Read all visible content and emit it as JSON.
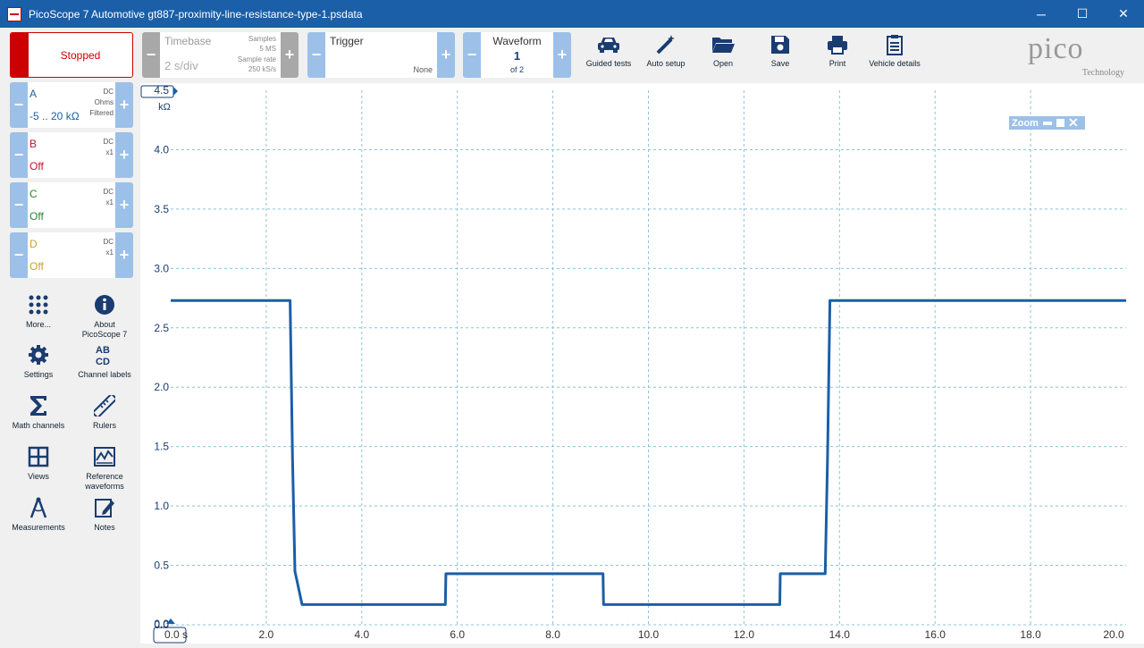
{
  "window": {
    "title": "PicoScope 7 Automotive gt887-proximity-line-resistance-type-1.psdata",
    "minimize": "─",
    "maximize": "☐",
    "close": "✕"
  },
  "run_status": "Stopped",
  "timebase": {
    "label": "Timebase",
    "value": "2 s/div",
    "samples_label": "Samples",
    "samples_value": "5 MS",
    "rate_label": "Sample rate",
    "rate_value": "250 kS/s"
  },
  "trigger": {
    "label": "Trigger",
    "value": "None"
  },
  "waveform": {
    "label": "Waveform",
    "value": "1",
    "of": "of 2"
  },
  "toolbar": [
    {
      "label": "Guided tests",
      "icon": "car-icon"
    },
    {
      "label": "Auto setup",
      "icon": "wand-icon"
    },
    {
      "label": "Open",
      "icon": "folder-icon"
    },
    {
      "label": "Save",
      "icon": "save-icon"
    },
    {
      "label": "Print",
      "icon": "printer-icon"
    },
    {
      "label": "Vehicle details",
      "icon": "clipboard-icon"
    }
  ],
  "logo": {
    "text": "pico",
    "sub": "Technology"
  },
  "channels": [
    {
      "name": "A",
      "coupling": "DC",
      "probe": "Ohms",
      "filter": "Filtered",
      "range": "-5 .. 20 kΩ",
      "color": "#1a5fa8"
    },
    {
      "name": "B",
      "coupling": "DC",
      "probe": "x1",
      "filter": "",
      "range": "Off",
      "color": "#c8102e"
    },
    {
      "name": "C",
      "coupling": "DC",
      "probe": "x1",
      "filter": "",
      "range": "Off",
      "color": "#1e8a2e"
    },
    {
      "name": "D",
      "coupling": "DC",
      "probe": "x1",
      "filter": "",
      "range": "Off",
      "color": "#c9a227"
    }
  ],
  "sidebar": [
    {
      "label": "More...",
      "icon": "dots-grid-icon"
    },
    {
      "label": "About PicoScope 7",
      "icon": "info-icon"
    },
    {
      "label": "Settings",
      "icon": "gear-icon"
    },
    {
      "label": "Channel labels",
      "icon": "abcd-icon"
    },
    {
      "label": "Math channels",
      "icon": "sigma-icon"
    },
    {
      "label": "Rulers",
      "icon": "ruler-icon"
    },
    {
      "label": "Views",
      "icon": "views-grid-icon"
    },
    {
      "label": "Reference waveforms",
      "icon": "reference-waveform-icon"
    },
    {
      "label": "Measurements",
      "icon": "compass-icon"
    },
    {
      "label": "Notes",
      "icon": "notes-icon"
    }
  ],
  "zoom_label": "Zoom",
  "chart_data": {
    "type": "line",
    "ylabel": "kΩ",
    "xlim": [
      0,
      20
    ],
    "ylim": [
      0,
      4.5
    ],
    "x_ticks": [
      "0.0 s",
      "2.0",
      "4.0",
      "6.0",
      "8.0",
      "10.0",
      "12.0",
      "14.0",
      "16.0",
      "18.0",
      "20.0"
    ],
    "y_ticks": [
      "4.5",
      "4.0",
      "3.5",
      "3.0",
      "2.5",
      "2.0",
      "1.5",
      "1.0",
      "0.5",
      "0.0",
      "0.0"
    ],
    "grid": true,
    "series": [
      {
        "color": "#1a5fa8",
        "x": [
          0,
          2.5,
          2.55,
          2.6,
          2.75,
          5.75,
          5.76,
          9.05,
          9.06,
          12.75,
          12.76,
          13.7,
          13.75,
          13.8,
          20
        ],
        "y": [
          2.73,
          2.73,
          1.4,
          0.45,
          0.17,
          0.17,
          0.43,
          0.43,
          0.17,
          0.17,
          0.43,
          0.43,
          1.4,
          2.73,
          2.73
        ]
      }
    ]
  }
}
